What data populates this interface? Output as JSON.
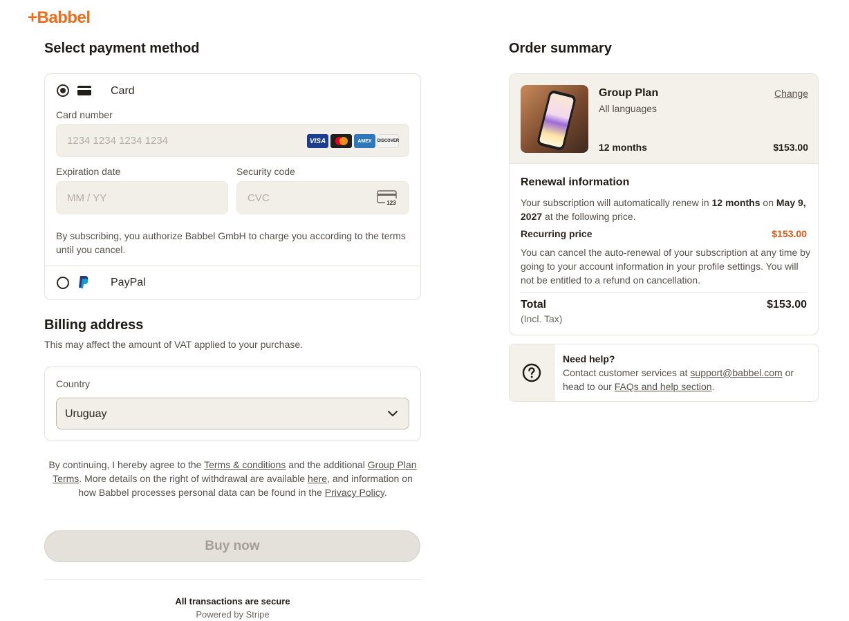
{
  "brand": {
    "logo": "+Babbel",
    "accent": "#ef6c1a"
  },
  "payment": {
    "title": "Select payment method",
    "methods": [
      {
        "label": "Card",
        "selected": true,
        "icon": "credit-card-icon"
      },
      {
        "label": "PayPal",
        "selected": false,
        "icon": "paypal-icon"
      }
    ],
    "card_number_label": "Card number",
    "card_number_placeholder": "1234 1234 1234 1234",
    "card_brands": [
      "VISA",
      "Mastercard",
      "AMEX",
      "DISCOVER"
    ],
    "expiration_label": "Expiration date",
    "expiration_placeholder": "MM / YY",
    "security_label": "Security code",
    "security_placeholder": "CVC",
    "cvc_icon_text": "123",
    "authorization_note": "By subscribing, you authorize Babbel GmbH to charge you according to the terms until you cancel."
  },
  "billing": {
    "title": "Billing address",
    "subtitle": "This may affect the amount of VAT applied to your purchase.",
    "country_label": "Country",
    "country_value": "Uruguay"
  },
  "legal": {
    "part1": "By continuing, I hereby agree to the ",
    "terms_link": "Terms & conditions",
    "part2": " and the additional ",
    "group_terms_link": "Group Plan Terms",
    "part3": ". More details on the right of withdrawal are available ",
    "here_link": "here",
    "part4": ", and information on how Babbel processes personal data can be found in the ",
    "privacy_link": "Privacy Policy",
    "part5": "."
  },
  "buy_button": "Buy now",
  "secure": {
    "title": "All transactions are secure",
    "powered": "Powered by Stripe"
  },
  "order": {
    "title": "Order summary",
    "plan_name": "Group Plan",
    "plan_langs": "All languages",
    "change_link": "Change",
    "term": "12 months",
    "price": "$153.00",
    "renewal_title": "Renewal information",
    "renewal_pre": "Your subscription will automatically renew in ",
    "renewal_bold1": "12 months",
    "renewal_mid": " on ",
    "renewal_bold2": "May 9, 2027",
    "renewal_post": " at the following price.",
    "recurring_label": "Recurring price",
    "recurring_price": "$153.00",
    "cancel_note": "You can cancel the auto-renewal of your subscription at any time by going to your account information in your profile settings. You will not be entitled to a refund on cancellation.",
    "total_label": "Total",
    "total_price": "$153.00",
    "total_sub": "(Incl. Tax)"
  },
  "help": {
    "title": "Need help?",
    "text1": "Contact customer services at ",
    "email_link": "support@babbel.com",
    "text2": " or head to our ",
    "faq_link": "FAQs and help section",
    "text3": "."
  },
  "colors": {
    "price_accent": "#d85a14",
    "field_bg": "#f2efe9",
    "panel_bg": "#f4f1eb"
  }
}
